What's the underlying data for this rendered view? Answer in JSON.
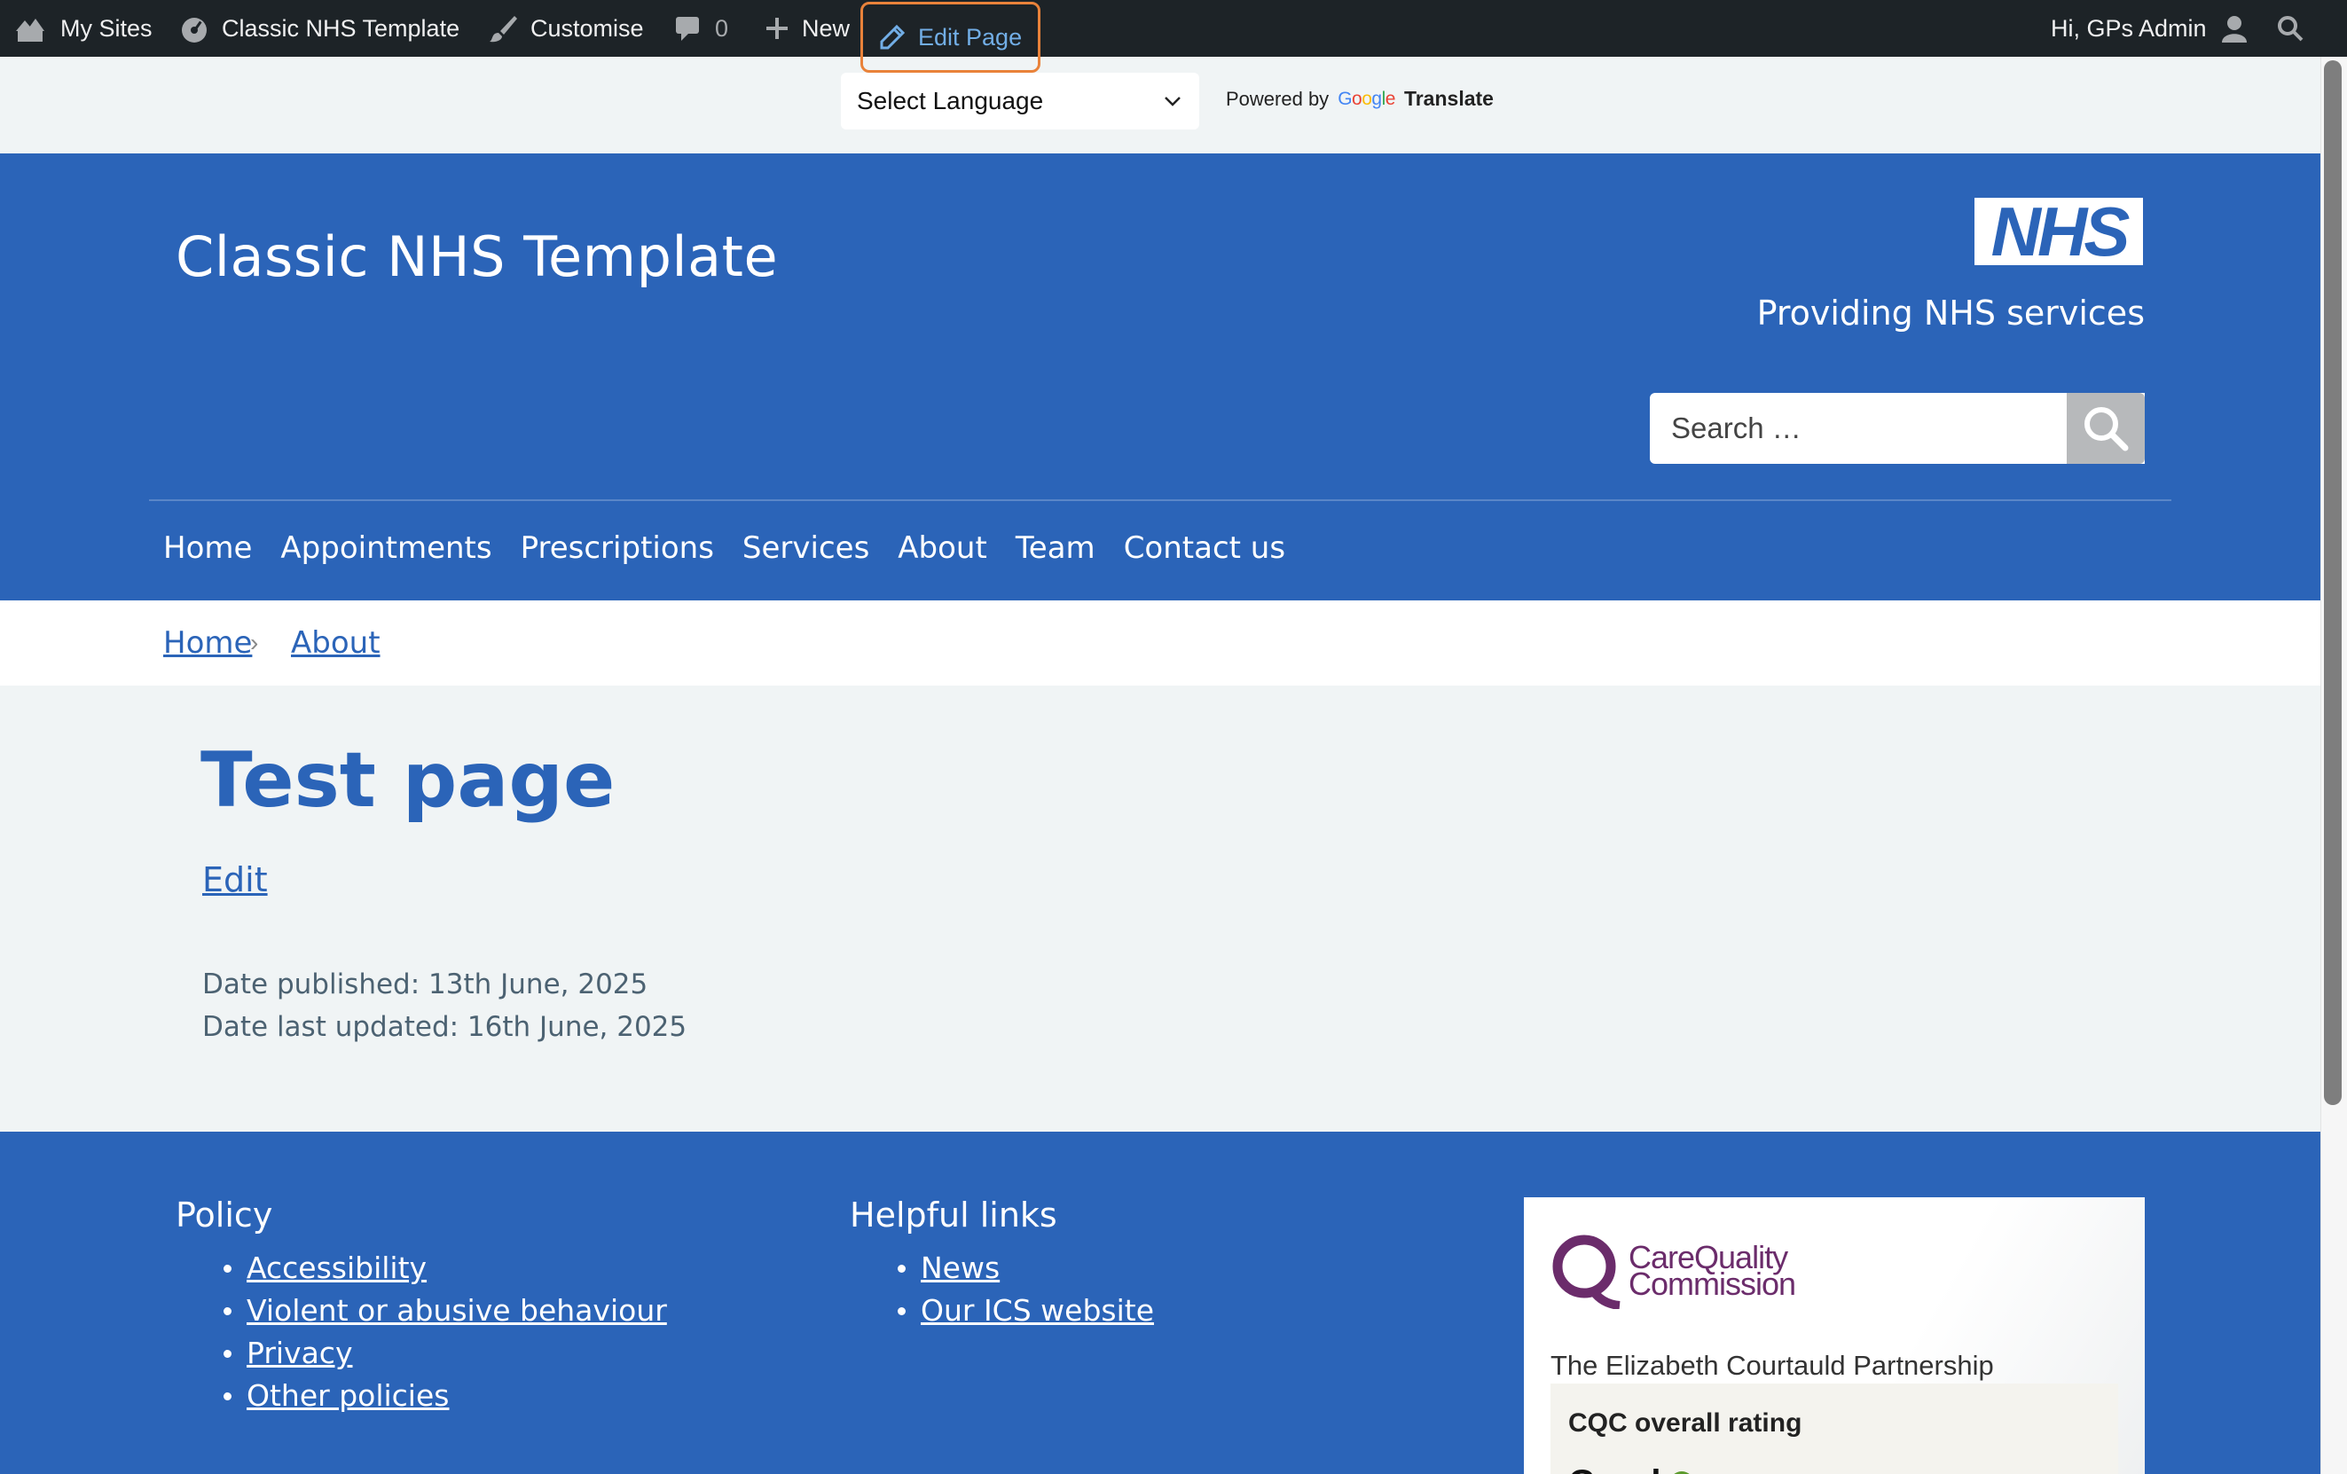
{
  "admin_bar": {
    "my_sites": "My Sites",
    "site_name": "Classic NHS Template",
    "customise": "Customise",
    "comments_count": "0",
    "new": "New",
    "edit_page": "Edit Page",
    "greeting": "Hi, GPs Admin"
  },
  "translate": {
    "select_label": "Select Language",
    "powered_by": "Powered by",
    "google": "Google",
    "translate": "Translate"
  },
  "header": {
    "site_title": "Classic NHS Template",
    "nhs_logo_text": "NHS",
    "tagline": "Providing NHS services",
    "search_placeholder": "Search …"
  },
  "nav": {
    "items": [
      "Home",
      "Appointments",
      "Prescriptions",
      "Services",
      "About",
      "Team",
      "Contact us"
    ]
  },
  "breadcrumb": {
    "items": [
      "Home",
      "About"
    ]
  },
  "main": {
    "title": "Test page",
    "edit_link": "Edit",
    "date_published": "Date published: 13th June, 2025",
    "date_updated": "Date last updated: 16th June, 2025"
  },
  "footer": {
    "policy": {
      "heading": "Policy",
      "links": [
        "Accessibility",
        "Violent or abusive behaviour",
        "Privacy",
        "Other policies"
      ]
    },
    "helpful": {
      "heading": "Helpful links",
      "links": [
        "News",
        "Our ICS website"
      ]
    },
    "cqc": {
      "logo_line1": "CareQuality",
      "logo_line2": "Commission",
      "provider": "The Elizabeth Courtauld Partnership",
      "rating_label": "CQC overall rating",
      "rating": "Good"
    }
  },
  "colors": {
    "nhs_blue": "#2b64b8",
    "admin_bar": "#1d2327",
    "edit_highlight": "#e9823a",
    "good_rating": "#5b9a2b"
  }
}
